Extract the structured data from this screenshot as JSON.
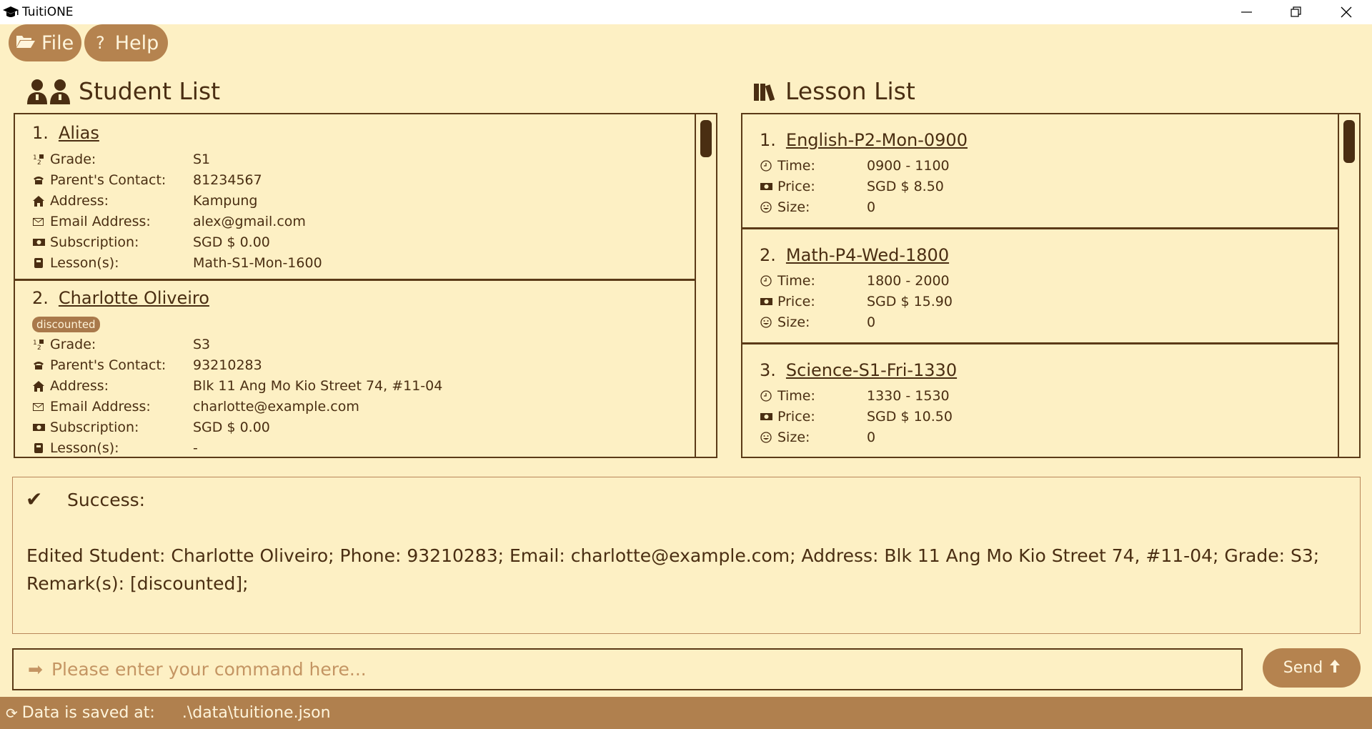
{
  "window": {
    "title": "TuitiONE",
    "controls": [
      "minimize",
      "restore",
      "close"
    ]
  },
  "menu": {
    "file_label": "File",
    "help_label": "Help"
  },
  "student_panel": {
    "title": "Student List",
    "labels": {
      "grade": "Grade:",
      "contact": "Parent's Contact:",
      "address": "Address:",
      "email": "Email Address:",
      "subscription": "Subscription:",
      "lessons": "Lesson(s):"
    },
    "students": [
      {
        "index": "1.",
        "name": "Alias",
        "tags": [],
        "grade": "S1",
        "contact": "81234567",
        "address": "Kampung",
        "email": "alex@gmail.com",
        "subscription": "SGD $ 0.00",
        "lessons": "Math-S1-Mon-1600"
      },
      {
        "index": "2.",
        "name": "Charlotte Oliveiro",
        "tags": [
          "discounted"
        ],
        "grade": "S3",
        "contact": "93210283",
        "address": "Blk 11 Ang Mo Kio Street 74, #11-04",
        "email": "charlotte@example.com",
        "subscription": "SGD $ 0.00",
        "lessons": "-"
      }
    ]
  },
  "lesson_panel": {
    "title": "Lesson List",
    "labels": {
      "time": "Time:",
      "price": "Price:",
      "size": "Size:"
    },
    "lessons": [
      {
        "index": "1.",
        "code": "English-P2-Mon-0900",
        "time": "0900 - 1100",
        "price": "SGD $ 8.50",
        "size": "0"
      },
      {
        "index": "2.",
        "code": "Math-P4-Wed-1800",
        "time": "1800 - 2000",
        "price": "SGD $ 15.90",
        "size": "0"
      },
      {
        "index": "3.",
        "code": "Science-S1-Fri-1330",
        "time": "1330 - 1530",
        "price": "SGD $ 10.50",
        "size": "0"
      }
    ]
  },
  "result": {
    "icon": "check-icon",
    "status": "Success:",
    "message": "Edited Student: Charlotte Oliveiro; Phone: 93210283; Email: charlotte@example.com; Address: Blk 11 Ang Mo Kio Street 74, #11-04; Grade: S3; Remark(s): [discounted];"
  },
  "command": {
    "placeholder": "Please enter your command here...",
    "value": "",
    "send_label": "Send"
  },
  "status_bar": {
    "label": "Data is saved at:",
    "path": ".\\data\\tuitione.json"
  },
  "colors": {
    "background": "#fdf0c4",
    "text": "#4a2e12",
    "accent": "#b5834f",
    "border": "#5b3a17"
  }
}
